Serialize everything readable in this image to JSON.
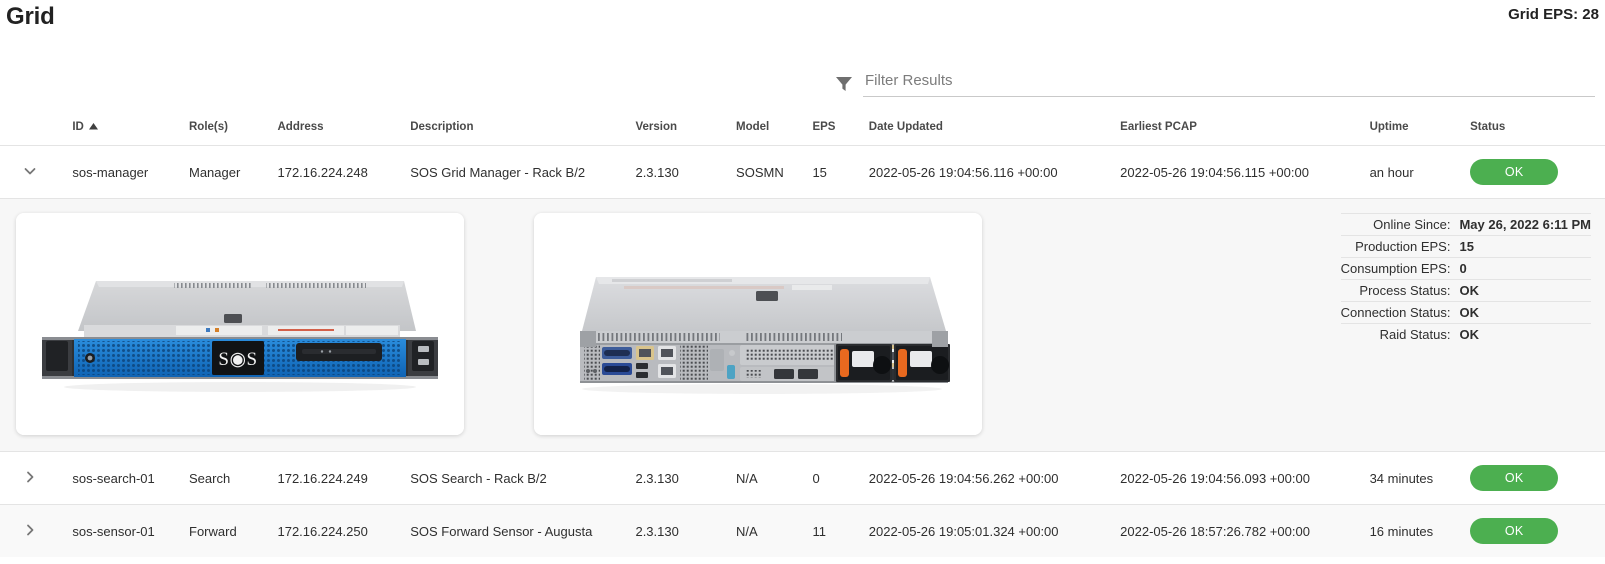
{
  "header": {
    "title": "Grid",
    "grid_eps_label": "Grid EPS: 28"
  },
  "filter": {
    "placeholder": "Filter Results",
    "value": "",
    "icon": "filter-funnel-icon"
  },
  "table": {
    "columns": [
      {
        "key": "toggle",
        "label": ""
      },
      {
        "key": "id",
        "label": "ID",
        "sort": "asc"
      },
      {
        "key": "roles",
        "label": "Role(s)"
      },
      {
        "key": "address",
        "label": "Address"
      },
      {
        "key": "description",
        "label": "Description"
      },
      {
        "key": "version",
        "label": "Version"
      },
      {
        "key": "model",
        "label": "Model"
      },
      {
        "key": "eps",
        "label": "EPS"
      },
      {
        "key": "date_updated",
        "label": "Date Updated"
      },
      {
        "key": "earliest_pcap",
        "label": "Earliest PCAP"
      },
      {
        "key": "uptime",
        "label": "Uptime"
      },
      {
        "key": "status",
        "label": "Status"
      }
    ],
    "rows": [
      {
        "expanded": true,
        "id": "sos-manager",
        "roles": "Manager",
        "address": "172.16.224.248",
        "description": "SOS Grid Manager - Rack B/2",
        "version": "2.3.130",
        "model": "SOSMN",
        "eps": "15",
        "date_updated": "2022-05-26 19:04:56.116 +00:00",
        "earliest_pcap": "2022-05-26 19:04:56.115 +00:00",
        "uptime": "an hour",
        "status": "OK"
      },
      {
        "expanded": false,
        "id": "sos-search-01",
        "roles": "Search",
        "address": "172.16.224.249",
        "description": "SOS Search - Rack B/2",
        "version": "2.3.130",
        "model": "N/A",
        "eps": "0",
        "date_updated": "2022-05-26 19:04:56.262 +00:00",
        "earliest_pcap": "2022-05-26 19:04:56.093 +00:00",
        "uptime": "34 minutes",
        "status": "OK"
      },
      {
        "expanded": false,
        "id": "sos-sensor-01",
        "roles": "Forward",
        "address": "172.16.224.250",
        "description": "SOS Forward Sensor - Augusta",
        "version": "2.3.130",
        "model": "N/A",
        "eps": "11",
        "date_updated": "2022-05-26 19:05:01.324 +00:00",
        "earliest_pcap": "2022-05-26 18:57:26.782 +00:00",
        "uptime": "16 minutes",
        "status": "OK"
      }
    ]
  },
  "detail": {
    "image_front_alt": "server-front-view",
    "image_rear_alt": "server-rear-view",
    "brand_text": "SOS",
    "stats": [
      {
        "label": "Online Since:",
        "value": "May 26, 2022 6:11 PM"
      },
      {
        "label": "Production EPS:",
        "value": "15"
      },
      {
        "label": "Consumption EPS:",
        "value": "0"
      },
      {
        "label": "Process Status:",
        "value": "OK"
      },
      {
        "label": "Connection Status:",
        "value": "OK"
      },
      {
        "label": "Raid Status:",
        "value": "OK"
      }
    ]
  },
  "colors": {
    "status_ok": "#4caf50",
    "bezel_blue": "#1e7fd4",
    "panel_bg": "#f7f7f7"
  }
}
